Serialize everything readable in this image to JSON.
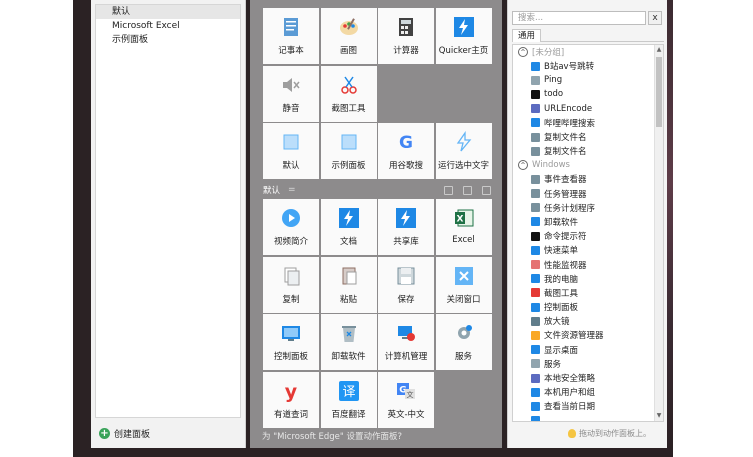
{
  "left_panel": {
    "items": [
      "默认",
      "Microsoft Excel",
      "示例面板"
    ],
    "create_label": "创建面板"
  },
  "middle_panel": {
    "top_tiles": [
      {
        "label": "记事本",
        "icon": "notepad-icon"
      },
      {
        "label": "画图",
        "icon": "paint-icon"
      },
      {
        "label": "计算器",
        "icon": "calculator-icon"
      },
      {
        "label": "Quicker主页",
        "icon": "quicker-icon"
      },
      {
        "label": "静音",
        "icon": "mute-icon"
      },
      {
        "label": "截图工具",
        "icon": "snipping-icon"
      },
      {
        "label": "",
        "icon": ""
      },
      {
        "label": "",
        "icon": ""
      },
      {
        "label": "默认",
        "icon": "panel-icon"
      },
      {
        "label": "示例面板",
        "icon": "panel-icon"
      },
      {
        "label": "用谷歌搜",
        "icon": "google-icon"
      },
      {
        "label": "运行选中文字",
        "icon": "run-icon"
      }
    ],
    "section_name": "默认",
    "section_sep": "=",
    "bottom_tiles": [
      {
        "label": "视频简介",
        "icon": "play-icon"
      },
      {
        "label": "文档",
        "icon": "quicker-icon"
      },
      {
        "label": "共享库",
        "icon": "quicker-icon"
      },
      {
        "label": "Excel",
        "icon": "excel-icon"
      },
      {
        "label": "复制",
        "icon": "copy-icon"
      },
      {
        "label": "粘贴",
        "icon": "paste-icon"
      },
      {
        "label": "保存",
        "icon": "save-icon"
      },
      {
        "label": "关闭窗口",
        "icon": "close-window-icon"
      },
      {
        "label": "控制面板",
        "icon": "control-panel-icon"
      },
      {
        "label": "卸载软件",
        "icon": "uninstall-icon"
      },
      {
        "label": "计算机管理",
        "icon": "computer-manage-icon"
      },
      {
        "label": "服务",
        "icon": "services-icon"
      },
      {
        "label": "有道查词",
        "icon": "youdao-icon"
      },
      {
        "label": "百度翻译",
        "icon": "baidu-translate-icon"
      },
      {
        "label": "英文-中文",
        "icon": "translate-icon"
      },
      {
        "label": "",
        "icon": ""
      }
    ],
    "footer": "为 \"Microsoft Edge\" 设置动作面板?"
  },
  "right_panel": {
    "search_placeholder": "搜索...",
    "clear_label": "x",
    "tab": "通用",
    "groups": [
      {
        "name": "[未分组]",
        "items": [
          "B站av号跳转",
          "Ping",
          "todo",
          "URLEncode",
          "哔哩哔哩搜索",
          "复制文件名",
          "复制文件名"
        ]
      },
      {
        "name": "Windows",
        "items": [
          "事件查看器",
          "任务管理器",
          "任务计划程序",
          "卸载软件",
          "命令提示符",
          "快速菜单",
          "性能监视器",
          "我的电脑",
          "截图工具",
          "控制面板",
          "放大镜",
          "文件资源管理器",
          "显示桌面",
          "服务",
          "本地安全策略",
          "本机用户和组",
          "查看当前日期",
          "..."
        ]
      }
    ],
    "footer": "拖动到动作面板上。"
  },
  "colors": {
    "quicker_blue": "#1e88e5",
    "excel_green": "#1e7145",
    "create_green": "#3aa35a"
  }
}
